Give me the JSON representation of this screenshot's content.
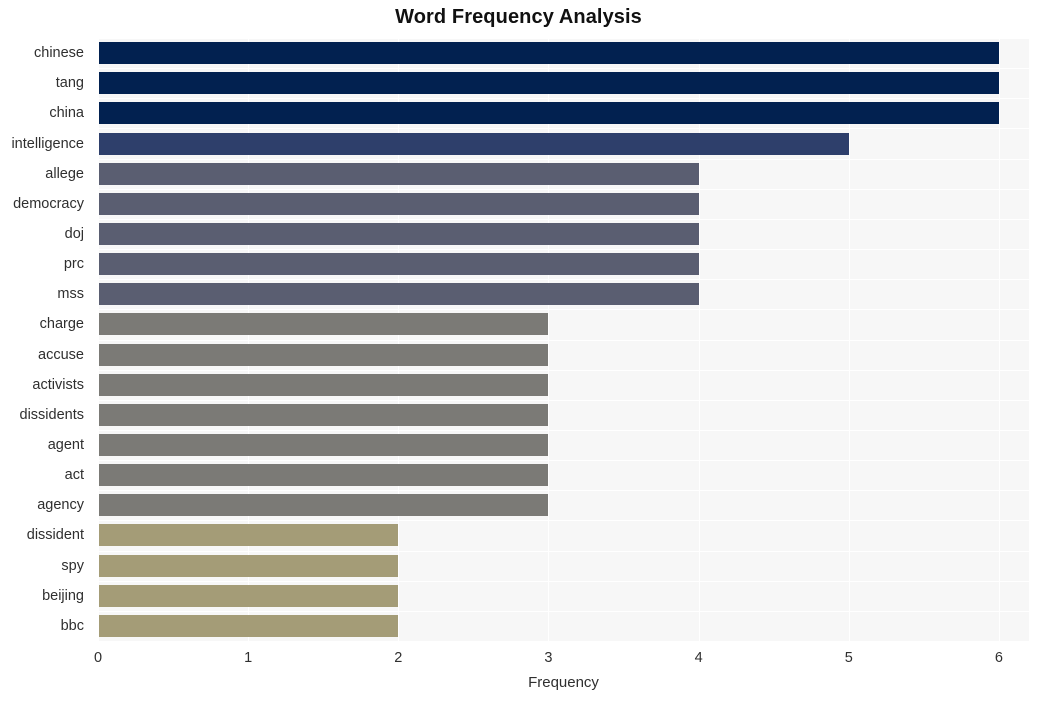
{
  "chart_data": {
    "type": "bar",
    "orientation": "horizontal",
    "title": "Word Frequency Analysis",
    "xlabel": "Frequency",
    "ylabel": "",
    "xlim": [
      0,
      6.2
    ],
    "xticks": [
      0,
      1,
      2,
      3,
      4,
      5,
      6
    ],
    "xtick_labels": [
      "0",
      "1",
      "2",
      "3",
      "4",
      "5",
      "6"
    ],
    "grid": true,
    "legend": null,
    "categories": [
      "chinese",
      "tang",
      "china",
      "intelligence",
      "allege",
      "democracy",
      "doj",
      "prc",
      "mss",
      "charge",
      "accuse",
      "activists",
      "dissidents",
      "agent",
      "act",
      "agency",
      "dissident",
      "spy",
      "beijing",
      "bbc"
    ],
    "values": [
      6,
      6,
      6,
      5,
      4,
      4,
      4,
      4,
      4,
      3,
      3,
      3,
      3,
      3,
      3,
      3,
      2,
      2,
      2,
      2
    ],
    "bar_colors": [
      "#022150",
      "#022150",
      "#022150",
      "#2e3f6b",
      "#5a5e71",
      "#5a5e71",
      "#5a5e71",
      "#5a5e71",
      "#5a5e71",
      "#7b7a76",
      "#7b7a76",
      "#7b7a76",
      "#7b7a76",
      "#7b7a76",
      "#7b7a76",
      "#7b7a76",
      "#a49c77",
      "#a49c77",
      "#a49c77",
      "#a49c77"
    ],
    "plot_background": "#f7f7f7",
    "gridline_color": "#ffffff",
    "figure_background": "#ffffff"
  }
}
